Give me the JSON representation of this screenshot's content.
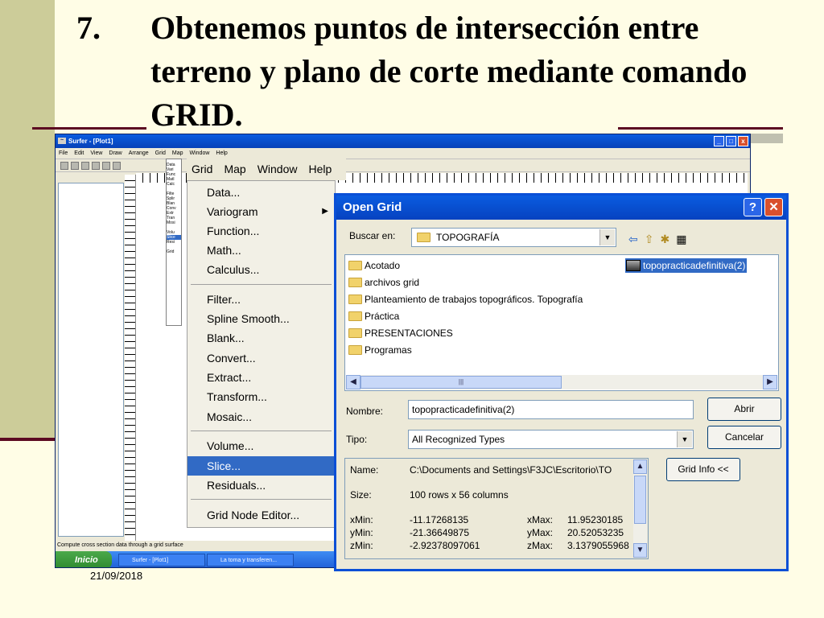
{
  "slide": {
    "number": "7.",
    "title": "Obtenemos puntos de intersección entre terreno y plano de corte mediante comando GRID.",
    "date": "21/09/2018"
  },
  "surfer": {
    "window_title": "Surfer - [Plot1]",
    "menu": [
      "File",
      "Edit",
      "View",
      "Draw",
      "Arrange",
      "Grid",
      "Map",
      "Window",
      "Help"
    ],
    "status": "Compute cross section data through a grid surface",
    "taskbar": {
      "start": "Inicio",
      "items": [
        "Surfer - [Plot1]",
        "La toma y transferen..."
      ]
    }
  },
  "grid_menu": {
    "bar": [
      "Grid",
      "Map",
      "Window",
      "Help"
    ],
    "items": [
      "Data...",
      "Variogram",
      "Function...",
      "Math...",
      "Calculus...",
      "Filter...",
      "Spline Smooth...",
      "Blank...",
      "Convert...",
      "Extract...",
      "Transform...",
      "Mosaic...",
      "Volume...",
      "Slice...",
      "Residuals...",
      "Grid Node Editor..."
    ],
    "selected": "Slice...",
    "mini_items": [
      "Data",
      "Vari",
      "Func",
      "Matl",
      "Calc",
      "Filte",
      "Splir",
      "Blan",
      "Conv",
      "Extr",
      "Tran",
      "Mosi",
      "Volu",
      "Slice",
      "Resi",
      "Grid"
    ]
  },
  "open_grid": {
    "title": "Open Grid",
    "help_btn": "?",
    "close_btn": "✕",
    "look_in_label": "Buscar en:",
    "look_in_value": "TOPOGRAFÍA",
    "folders": [
      "Acotado",
      "archivos grid",
      "Planteamiento de trabajos topográficos. Topografía",
      "Práctica",
      "PRESENTACIONES",
      "Programas"
    ],
    "selected_file": "topopracticadefinitiva(2)",
    "name_label": "Nombre:",
    "name_value": "topopracticadefinitiva(2)",
    "type_label": "Tipo:",
    "type_value": "All Recognized Types",
    "open_button": "Abrir",
    "cancel_button": "Cancelar",
    "info_button": "Grid Info <<",
    "info": {
      "name_label": "Name:",
      "name_value": "C:\\Documents and Settings\\F3JC\\Escritorio\\TO",
      "size_label": "Size:",
      "size_value": "100 rows x 56 columns",
      "xmin_label": "xMin:",
      "xmin": "-11.17268135",
      "xmax_label": "xMax:",
      "xmax": "11.95230185",
      "ymin_label": "yMin:",
      "ymin": "-21.36649875",
      "ymax_label": "yMax:",
      "ymax": "20.52053235",
      "zmin_label": "zMin:",
      "zmin": "-2.92378097061",
      "zmax_label": "zMax:",
      "zmax": "3.1379055968"
    }
  },
  "colors": {
    "title_bar": "#0a5ce0",
    "selection": "#316ac5",
    "accent_line": "#5c0a22",
    "left_band": "#cccc99"
  }
}
